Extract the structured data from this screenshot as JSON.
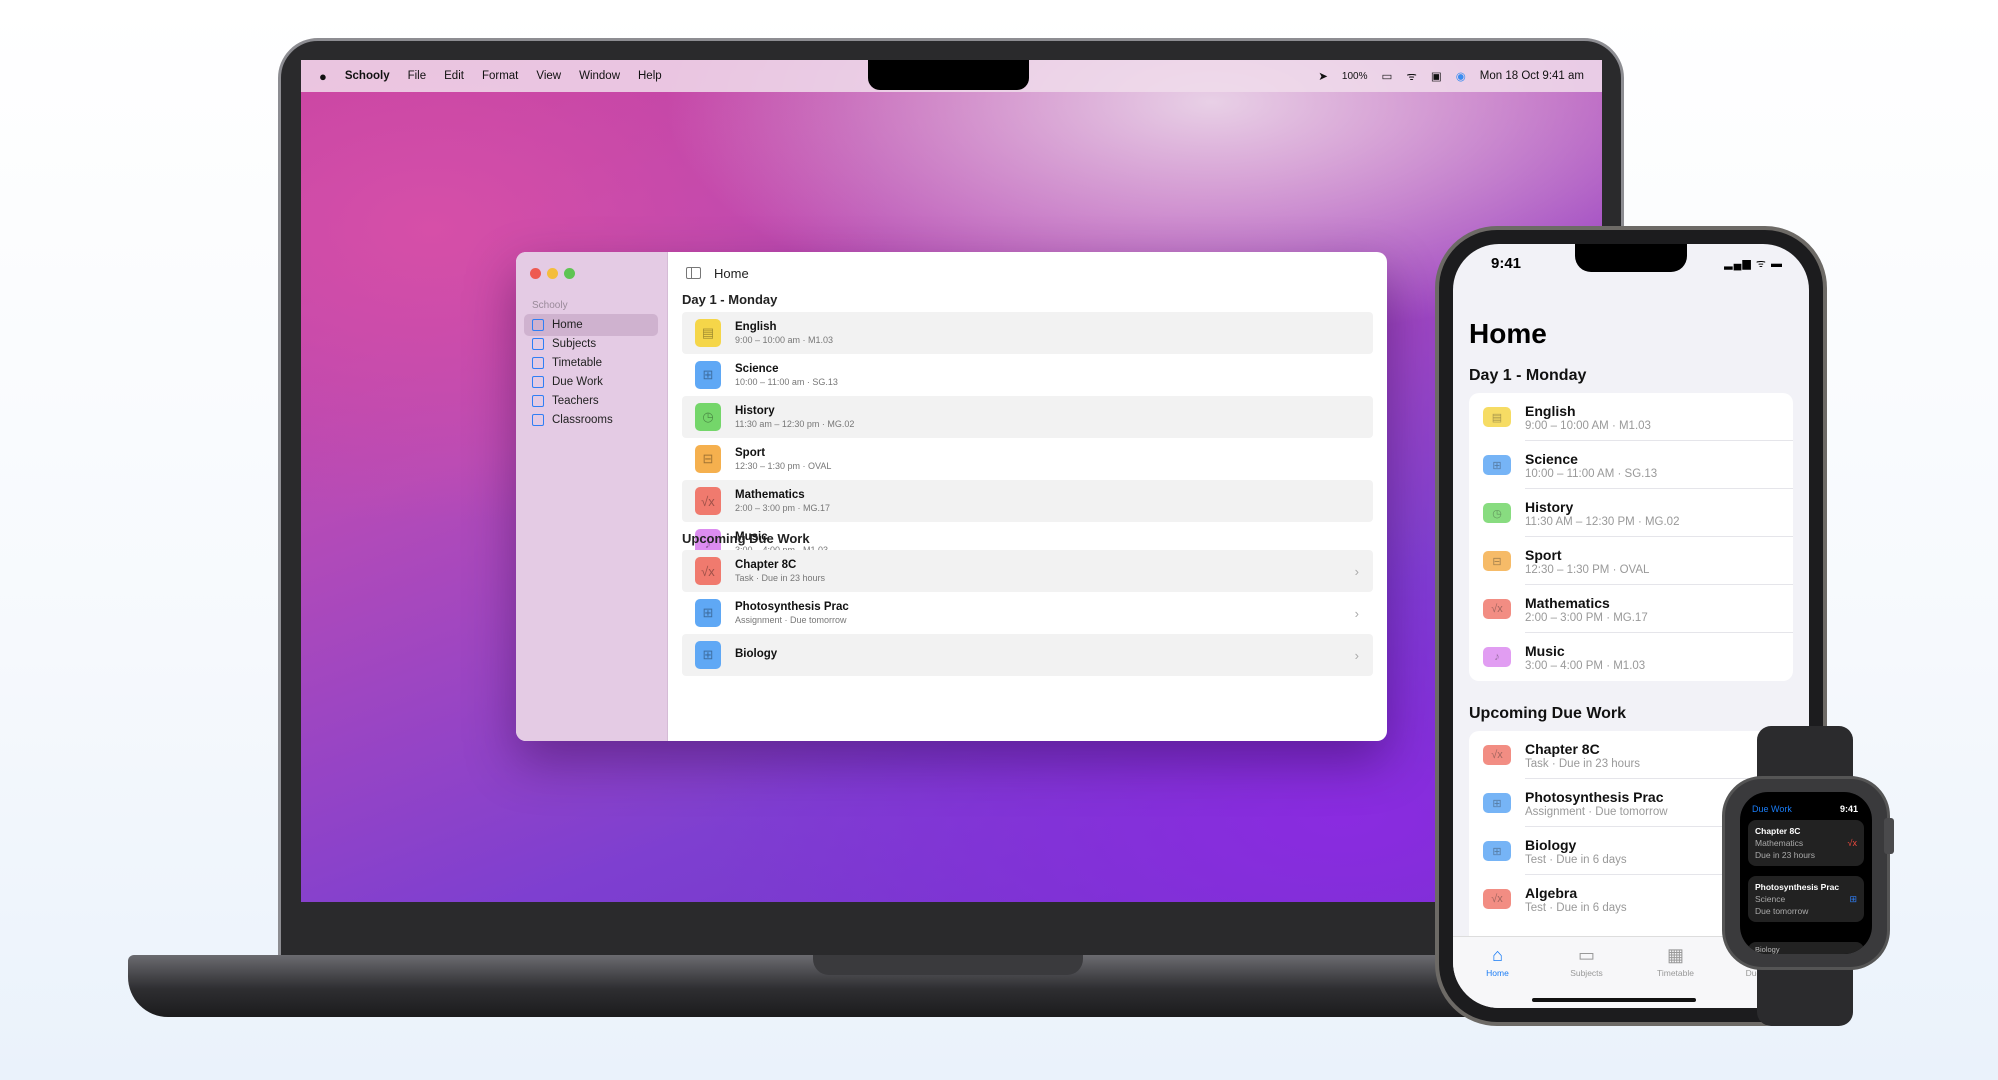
{
  "colors": {
    "accent": "#2f7ef5",
    "yellow": "#f5d649",
    "blue": "#5fa8f5",
    "green": "#74d66a",
    "orange": "#f5b04e",
    "red": "#f07a6e",
    "purple": "#dc8cf0"
  },
  "menubar": {
    "apple_icon": "apple-icon",
    "app": "Schooly",
    "items": [
      "File",
      "Edit",
      "Format",
      "View",
      "Window",
      "Help"
    ],
    "battery": "100%",
    "datetime": "Mon 18 Oct  9:41 am"
  },
  "mac": {
    "sidebar": {
      "section": "Schooly",
      "items": [
        {
          "label": "Home",
          "icon": "house-icon"
        },
        {
          "label": "Subjects",
          "icon": "folder-icon"
        },
        {
          "label": "Timetable",
          "icon": "calendar-icon"
        },
        {
          "label": "Due Work",
          "icon": "doc-icon"
        },
        {
          "label": "Teachers",
          "icon": "person-icon"
        },
        {
          "label": "Classrooms",
          "icon": "door-icon"
        }
      ]
    },
    "title": "Home",
    "day_heading": "Day 1 - Monday",
    "classes": [
      {
        "name": "English",
        "detail": "9:00 – 10:00 am · M1.03",
        "color": "yellow",
        "icon": "▤"
      },
      {
        "name": "Science",
        "detail": "10:00 – 11:00 am · SG.13",
        "color": "blue",
        "icon": "⊞"
      },
      {
        "name": "History",
        "detail": "11:30 am – 12:30 pm · MG.02",
        "color": "green",
        "icon": "◷"
      },
      {
        "name": "Sport",
        "detail": "12:30 – 1:30 pm · OVAL",
        "color": "orange",
        "icon": "⊟"
      },
      {
        "name": "Mathematics",
        "detail": "2:00 – 3:00 pm · MG.17",
        "color": "red",
        "icon": "√x"
      },
      {
        "name": "Music",
        "detail": "3:00 – 4:00 pm · M1.03",
        "color": "purple",
        "icon": "♪"
      }
    ],
    "due_heading": "Upcoming Due Work",
    "due": [
      {
        "name": "Chapter 8C",
        "detail": "Task · Due in 23 hours",
        "color": "red",
        "icon": "√x"
      },
      {
        "name": "Photosynthesis Prac",
        "detail": "Assignment · Due tomorrow",
        "color": "blue",
        "icon": "⊞"
      },
      {
        "name": "Biology",
        "detail": "",
        "color": "blue",
        "icon": "⊞"
      }
    ]
  },
  "iphone": {
    "time": "9:41",
    "status": "▂▄▆ ᯤ ▬",
    "title": "Home",
    "day_heading": "Day 1 - Monday",
    "classes": [
      {
        "name": "English",
        "detail": "9:00 – 10:00 AM · M1.03"
      },
      {
        "name": "Science",
        "detail": "10:00 – 11:00 AM · SG.13"
      },
      {
        "name": "History",
        "detail": "11:30 AM – 12:30 PM · MG.02"
      },
      {
        "name": "Sport",
        "detail": "12:30 – 1:30 PM · OVAL"
      },
      {
        "name": "Mathematics",
        "detail": "2:00 – 3:00 PM · MG.17"
      },
      {
        "name": "Music",
        "detail": "3:00 – 4:00 PM · M1.03"
      }
    ],
    "due_heading": "Upcoming Due Work",
    "due": [
      {
        "name": "Chapter 8C",
        "detail": "Task · Due in 23 hours"
      },
      {
        "name": "Photosynthesis Prac",
        "detail": "Assignment · Due tomorrow"
      },
      {
        "name": "Biology",
        "detail": "Test · Due in 6 days"
      },
      {
        "name": "Algebra",
        "detail": "Test · Due in 6 days"
      }
    ],
    "tabs": [
      {
        "label": "Home",
        "icon": "⌂"
      },
      {
        "label": "Subjects",
        "icon": "▭"
      },
      {
        "label": "Timetable",
        "icon": "▦"
      },
      {
        "label": "Due Work",
        "icon": "▤"
      }
    ]
  },
  "watch": {
    "header": "Due Work",
    "time": "9:41",
    "cards": [
      {
        "title": "Chapter 8C",
        "subject": "Mathematics",
        "due": "Due in 23 hours",
        "icon": "√x",
        "color": "#f04a3e"
      },
      {
        "title": "Photosynthesis Prac",
        "subject": "Science",
        "due": "Due tomorrow",
        "icon": "⊞",
        "color": "#2f7ef5"
      }
    ],
    "next": "Biology"
  }
}
